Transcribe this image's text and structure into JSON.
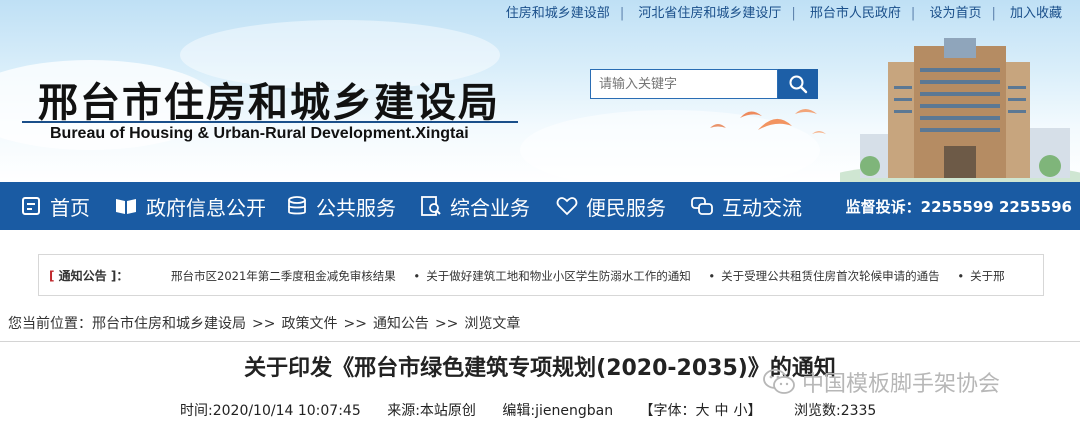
{
  "top_links": [
    "住房和城乡建设部",
    "河北省住房和城乡建设厅",
    "邢台市人民政府",
    "设为首页",
    "加入收藏"
  ],
  "site": {
    "title_cn": "邢台市住房和城乡建设局",
    "title_en": "Bureau of Housing & Urban-Rural Development.Xingtai"
  },
  "search": {
    "placeholder": "请输入关键字",
    "icon": "search-icon"
  },
  "nav": {
    "items": [
      {
        "label": "首页",
        "icon": "home-icon"
      },
      {
        "label": "政府信息公开",
        "icon": "book-icon"
      },
      {
        "label": "公共服务",
        "icon": "database-icon"
      },
      {
        "label": "综合业务",
        "icon": "document-search-icon"
      },
      {
        "label": "便民服务",
        "icon": "heart-icon"
      },
      {
        "label": "互动交流",
        "icon": "chat-icon"
      }
    ],
    "hotline": "监督投诉：2255599 2255596"
  },
  "notice": {
    "label_open": "[",
    "label_text": "通知公告",
    "label_close": "]：",
    "items": [
      "邢台市区2021年第二季度租金减免审核结果",
      "关于做好建筑工地和物业小区学生防溺水工作的通知",
      "关于受理公共租赁住房首次轮候申请的通告",
      "关于邢"
    ]
  },
  "breadcrumb": {
    "prefix": "您当前位置：",
    "items": [
      "邢台市住房和城乡建设局",
      "政策文件",
      "通知公告",
      "浏览文章"
    ]
  },
  "article": {
    "title": "关于印发《邢台市绿色建筑专项规划(2020-2035)》的通知",
    "time": "时间:2020/10/14 10:07:45",
    "source": "来源:本站原创",
    "editor": "编辑:jienengban",
    "font_label": "【字体：",
    "font_large": "大",
    "font_medium": "中",
    "font_small": "小",
    "font_close": "】",
    "views": "浏览数:2335"
  },
  "watermark": {
    "text": "中国模板脚手架协会",
    "icon": "wechat-icon"
  },
  "colors": {
    "nav_bg": "#1a5ba3",
    "accent": "#1d5fa7",
    "notice_red": "#c0282d"
  }
}
